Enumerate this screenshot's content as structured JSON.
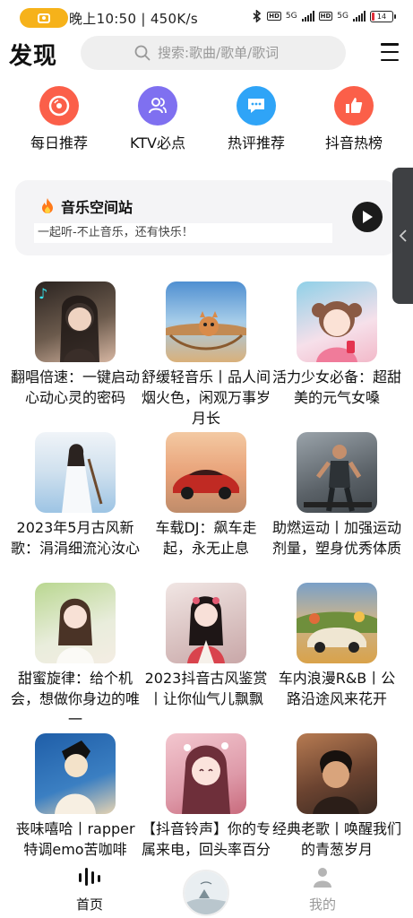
{
  "status_bar": {
    "time": "晚上10:50 | 450K/s",
    "network": "5G",
    "hd": "HD",
    "battery": "14"
  },
  "header": {
    "title": "发现",
    "search_placeholder": "搜索:歌曲/歌单/歌词"
  },
  "quick_actions": [
    {
      "label": "每日推荐",
      "icon": "vinyl-record-icon",
      "color": "#fb5f49"
    },
    {
      "label": "KTV必点",
      "icon": "users-icon",
      "color": "#7f70f0"
    },
    {
      "label": "热评推荐",
      "icon": "comment-icon",
      "color": "#2fa4f7"
    },
    {
      "label": "抖音热榜",
      "icon": "thumbs-up-icon",
      "color": "#fb5f49"
    }
  ],
  "station": {
    "title": "音乐空间站",
    "subtitle": "一起听-不止音乐，还有快乐！",
    "icon": "fire-icon"
  },
  "playlists": [
    {
      "title": "翻唱倍速：一键启动心动心灵的密码",
      "colors": [
        "#6b5a4c",
        "#d6b6a2"
      ]
    },
    {
      "title": "舒缓轻音乐丨品人间烟火色，闲观万事岁月长",
      "colors": [
        "#4f8fd1",
        "#d98b4a"
      ]
    },
    {
      "title": "活力少女必备：超甜美的元气女嗓",
      "colors": [
        "#f2b9c9",
        "#8fd0e8"
      ]
    },
    {
      "title": "2023年5月古风新歌：涓涓细流沁汝心",
      "colors": [
        "#9dc4e4",
        "#f0f4f8"
      ]
    },
    {
      "title": "车载DJ：飙车走起，永无止息",
      "colors": [
        "#e9a37a",
        "#c02a23"
      ]
    },
    {
      "title": "助燃运动丨加强运动剂量，塑身优秀体质",
      "colors": [
        "#3d4348",
        "#9aa3aa"
      ]
    },
    {
      "title": "甜蜜旋律：给个机会，想做你身边的唯一",
      "colors": [
        "#b9d790",
        "#f4ede3"
      ]
    },
    {
      "title": "2023抖音古风鉴赏丨让你仙气儿飘飘",
      "colors": [
        "#c9a7a8",
        "#f1e6e4"
      ]
    },
    {
      "title": "车内浪漫R&B丨公路沿途风来花开",
      "colors": [
        "#d9a24a",
        "#7aa0c8"
      ]
    },
    {
      "title": "丧味嘻哈丨rapper特调emo苦咖啡",
      "colors": [
        "#3b7fc2",
        "#e6d3b2"
      ]
    },
    {
      "title": "【抖音铃声】你的专属来电，回头率百分百",
      "colors": [
        "#c96b7d",
        "#f3c7cf"
      ]
    },
    {
      "title": "经典老歌丨唤醒我们的青葱岁月",
      "colors": [
        "#3a2a22",
        "#b77b52"
      ]
    }
  ],
  "bottom_nav": {
    "home": "首页",
    "mine": "我的"
  }
}
